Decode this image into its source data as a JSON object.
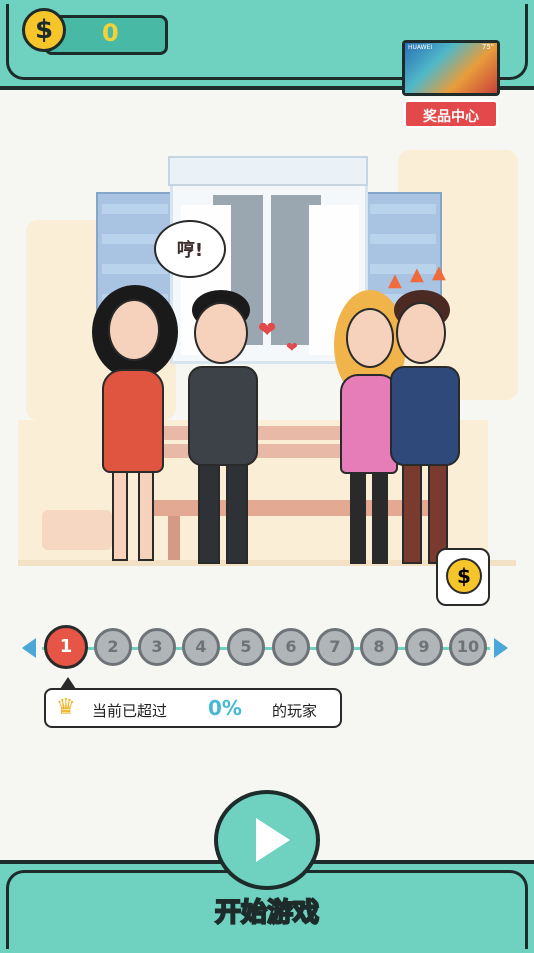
{
  "coins": {
    "count": "0",
    "icon": "dollar-coin-icon",
    "symbol": "$"
  },
  "prize_center": {
    "label": "奖品中心",
    "tv_brand": "HUAWEI",
    "tv_size": "75\""
  },
  "scene": {
    "speech_text": "哼!"
  },
  "levels": {
    "items": [
      "1",
      "2",
      "3",
      "4",
      "5",
      "6",
      "7",
      "8",
      "9",
      "10"
    ],
    "current": "1"
  },
  "stats": {
    "label": "当前已超过",
    "value": "0%",
    "suffix": "的玩家"
  },
  "start_button": {
    "label": "开始游戏"
  },
  "colors": {
    "teal": "#6fd1c0",
    "outline": "#1d2b2a",
    "active_level": "#e65545",
    "accent_blue": "#47b9d3",
    "gold": "#f6c52a"
  }
}
